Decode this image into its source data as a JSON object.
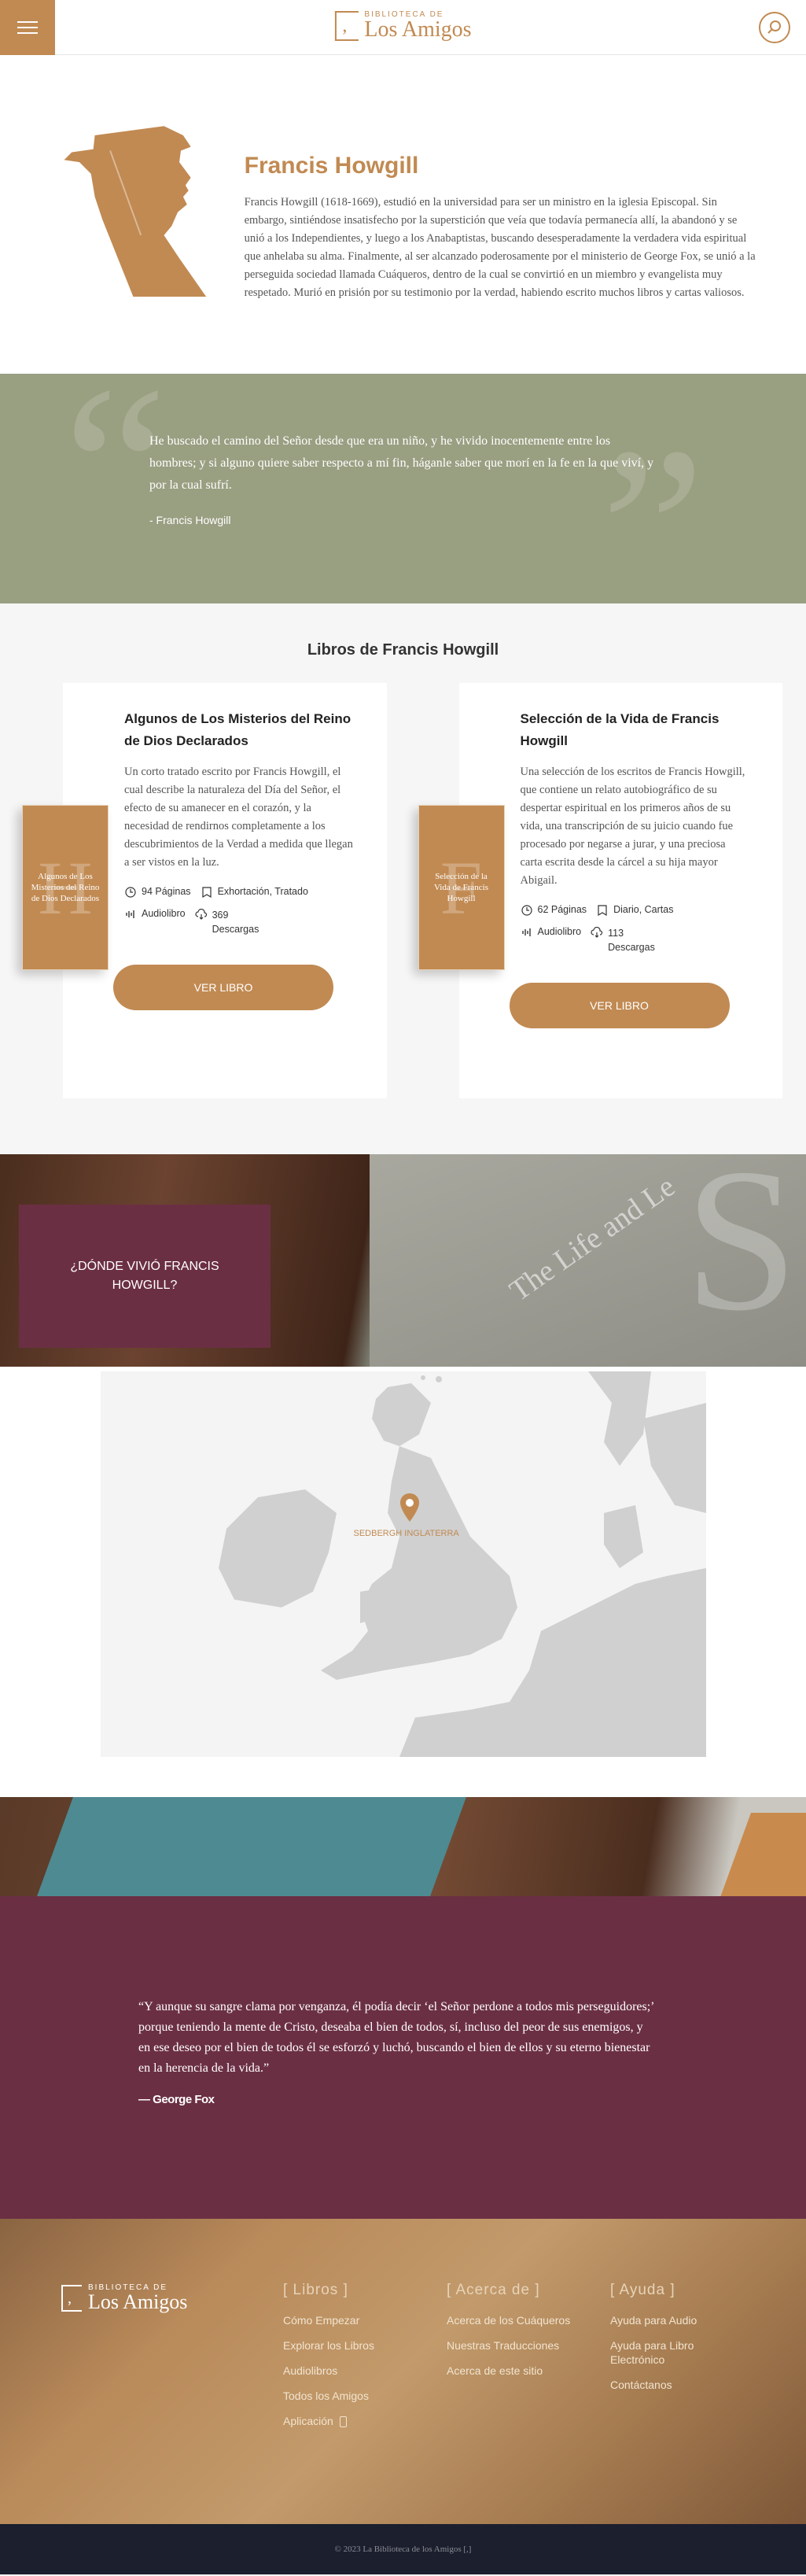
{
  "header": {
    "logo_small": "BIBLIOTECA DE",
    "logo_big": "Los Amigos"
  },
  "author": {
    "name": "Francis Howgill",
    "bio": "Francis Howgill (1618-1669), estudió en la universidad para ser un ministro en la iglesia Episcopal. Sin embargo, sintiéndose insatisfecho por la superstición que veía que todavía permanecía allí, la abandonó y se unió a los Independientes, y luego a los Anabaptistas, buscando desesperadamente la verdadera vida espiritual que anhelaba su alma. Finalmente, al ser alcanzado poderosamente por el ministerio de George Fox, se unió a la perseguida sociedad llamada Cuáqueros, dentro de la cual se convirtió en un miembro y evangelista muy respetado. Murió en prisión por su testimonio por la verdad, habiendo escrito muchos libros y cartas valiosos."
  },
  "quote1": {
    "text": "He buscado el camino del Señor desde que era un niño, y he vivido inocentemente entre los hombres; y si alguno quiere saber respecto a mí fin, háganle saber que morí en la fe en la que viví, y por la cual sufrí.",
    "author": "- Francis Howgill"
  },
  "books": {
    "title": "Libros de Francis Howgill",
    "items": [
      {
        "title": "Algunos de Los Misterios del Reino de Dios Declarados",
        "cover_title": "Algunos de Los Misterios del Reino de Dios Declarados",
        "cover_letter": "H",
        "description": "Un corto tratado escrito por Francis Howgill, el cual describe la naturaleza del Día del Señor, el efecto de su amanecer en el corazón, y la necesidad de rendirnos completamente a los descubrimientos de la Verdad a medida que llegan a ser vistos en la luz.",
        "pages": "94 Páginas",
        "genre": "Exhortación, Tratado",
        "audio": "Audiolibro",
        "downloads": "369 Descargas",
        "button": "VER LIBRO"
      },
      {
        "title": "Selección de la Vida de Francis Howgill",
        "cover_title": "Selección de la Vida de Francis Howgill",
        "cover_letter": "F",
        "description": "Una selección de los escritos de Francis Howgill, que contiene un relato autobiográfico de su despertar espiritual en los primeros años de su vida, una transcripción de su juicio cuando fue procesado por negarse a jurar, y una preciosa carta escrita desde la cárcel a su hija mayor Abigail.",
        "pages": "62 Páginas",
        "genre": "Diario, Cartas",
        "audio": "Audiolibro",
        "downloads": "113 Descargas",
        "button": "VER LIBRO"
      }
    ]
  },
  "banner1": {
    "where": "¿DÓNDE VIVIÓ FRANCIS HOWGILL?",
    "book_letter": "S",
    "book_spine": "The Life and Le"
  },
  "map": {
    "label": "SEDBERGH INGLATERRA"
  },
  "quote2": {
    "text": "“Y aunque su sangre clama por venganza, él podía decir ‘el Señor perdone a todos mis perseguidores;’ porque teniendo la mente de Cristo, deseaba el bien de todos, sí, incluso del peor de sus enemigos, y en ese deseo por el bien de todos él se esforzó y luchó, buscando el bien de ellos y su eterno bienestar en la herencia de la vida.”",
    "author": "— George Fox"
  },
  "footer": {
    "logo_small": "BIBLIOTECA DE",
    "logo_big": "Los Amigos",
    "columns": [
      {
        "title": "[ Libros ]",
        "links": [
          "Cómo Empezar",
          "Explorar los Libros",
          "Audiolibros",
          "Todos los Amigos",
          "Aplicación"
        ]
      },
      {
        "title": "[ Acerca de ]",
        "links": [
          "Acerca de los Cuáqueros",
          "Nuestras Traducciones",
          "Acerca de este sitio"
        ]
      },
      {
        "title": "[ Ayuda ]",
        "links": [
          "Ayuda para Audio",
          "Ayuda para Libro Electrónico",
          "Contáctanos"
        ]
      }
    ],
    "copyright": "© 2023 La Biblioteca de los Amigos [,]"
  },
  "colors": {
    "accent": "#c18a52",
    "green": "#999f81",
    "maroon": "#6b2f44",
    "dark": "#1b1f2e"
  }
}
